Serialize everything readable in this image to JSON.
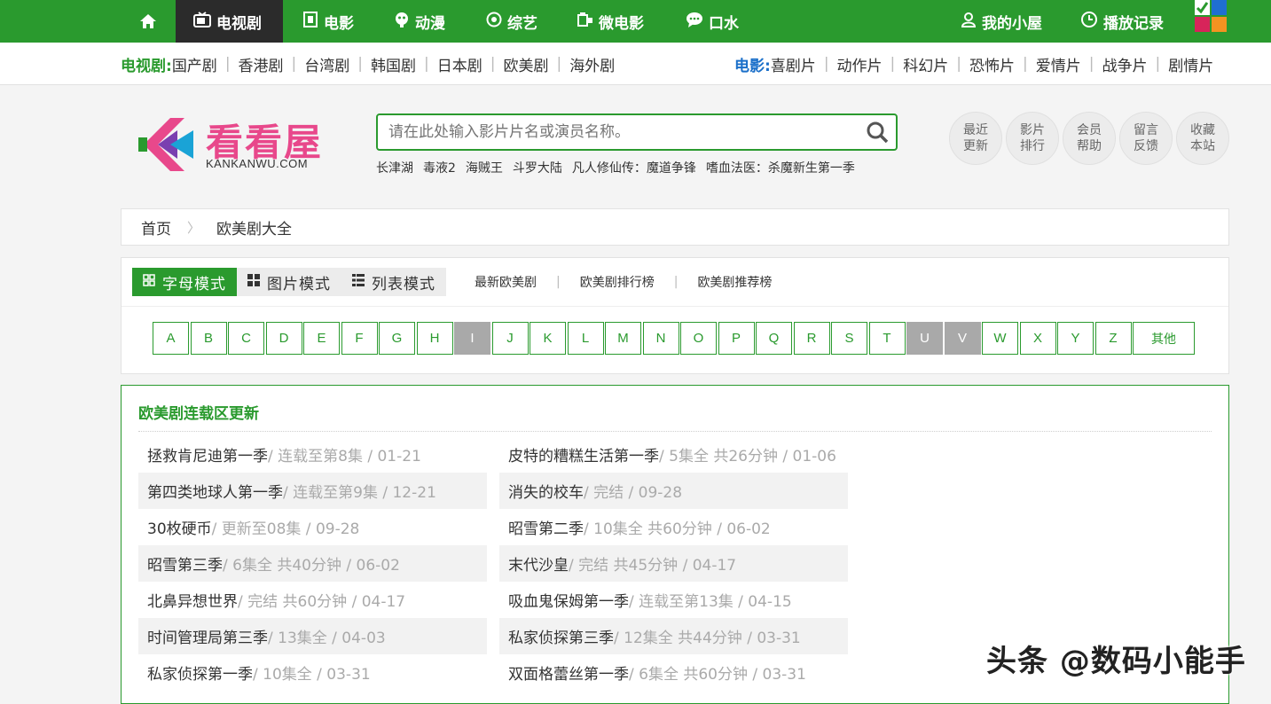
{
  "topnav": {
    "items": [
      {
        "label": "电视剧",
        "icon": "tv-icon"
      },
      {
        "label": "电影",
        "icon": "film-icon"
      },
      {
        "label": "动漫",
        "icon": "anime-icon"
      },
      {
        "label": "综艺",
        "icon": "variety-icon"
      },
      {
        "label": "微电影",
        "icon": "camera-icon"
      },
      {
        "label": "口水",
        "icon": "chat-icon"
      }
    ],
    "right": [
      {
        "label": "我的小屋",
        "icon": "user-icon"
      },
      {
        "label": "播放记录",
        "icon": "clock-icon"
      }
    ],
    "colors": {
      "green": "#2a9a2e",
      "active": "#2b2b2b"
    }
  },
  "subnav": {
    "tv_label": "电视剧:",
    "tv_links": [
      "国产剧",
      "香港剧",
      "台湾剧",
      "韩国剧",
      "日本剧",
      "欧美剧",
      "海外剧"
    ],
    "movie_label": "电影:",
    "movie_links": [
      "喜剧片",
      "动作片",
      "科幻片",
      "恐怖片",
      "爱情片",
      "战争片",
      "剧情片"
    ]
  },
  "logo": {
    "brand": "看看屋",
    "sub": "KANKANWU.COM"
  },
  "search": {
    "placeholder": "请在此处输入影片片名或演员名称。"
  },
  "hotwords": [
    "长津湖",
    "毒液2",
    "海贼王",
    "斗罗大陆",
    "凡人修仙传：魔道争锋",
    "嗜血法医：杀魔新生第一季"
  ],
  "quick": [
    [
      "最近",
      "更新"
    ],
    [
      "影片",
      "排行"
    ],
    [
      "会员",
      "帮助"
    ],
    [
      "留言",
      "反馈"
    ],
    [
      "收藏",
      "本站"
    ]
  ],
  "breadcrumb": {
    "home": "首页",
    "current": "欧美剧大全"
  },
  "modes": [
    {
      "label": "字母模式",
      "icon": "letter-grid-icon",
      "active": true
    },
    {
      "label": "图片模式",
      "icon": "image-grid-icon",
      "active": false
    },
    {
      "label": "列表模式",
      "icon": "list-icon",
      "active": false
    }
  ],
  "tab_links": [
    "最新欧美剧",
    "欧美剧排行榜",
    "欧美剧推荐榜"
  ],
  "letters": [
    {
      "ch": "A",
      "disabled": false
    },
    {
      "ch": "B",
      "disabled": false
    },
    {
      "ch": "C",
      "disabled": false
    },
    {
      "ch": "D",
      "disabled": false
    },
    {
      "ch": "E",
      "disabled": false
    },
    {
      "ch": "F",
      "disabled": false
    },
    {
      "ch": "G",
      "disabled": false
    },
    {
      "ch": "H",
      "disabled": false
    },
    {
      "ch": "I",
      "disabled": true
    },
    {
      "ch": "J",
      "disabled": false
    },
    {
      "ch": "K",
      "disabled": false
    },
    {
      "ch": "L",
      "disabled": false
    },
    {
      "ch": "M",
      "disabled": false
    },
    {
      "ch": "N",
      "disabled": false
    },
    {
      "ch": "O",
      "disabled": false
    },
    {
      "ch": "P",
      "disabled": false
    },
    {
      "ch": "Q",
      "disabled": false
    },
    {
      "ch": "R",
      "disabled": false
    },
    {
      "ch": "S",
      "disabled": false
    },
    {
      "ch": "T",
      "disabled": false
    },
    {
      "ch": "U",
      "disabled": true
    },
    {
      "ch": "V",
      "disabled": true
    },
    {
      "ch": "W",
      "disabled": false
    },
    {
      "ch": "X",
      "disabled": false
    },
    {
      "ch": "Y",
      "disabled": false
    },
    {
      "ch": "Z",
      "disabled": false
    },
    {
      "ch": "其他",
      "disabled": false
    }
  ],
  "updates": {
    "title": "欧美剧连载区更新",
    "left": [
      {
        "name": "拯救肯尼迪第一季",
        "meta": " / 连载至第8集 / 01-21"
      },
      {
        "name": "第四类地球人第一季",
        "meta": " / 连载至第9集 / 12-21"
      },
      {
        "name": "30枚硬币",
        "meta": " / 更新至08集 / 09-28"
      },
      {
        "name": "昭雪第三季",
        "meta": " / 6集全 共40分钟 / 06-02"
      },
      {
        "name": "北鼻异想世界",
        "meta": " / 完结 共60分钟 / 04-17"
      },
      {
        "name": "时间管理局第三季",
        "meta": " / 13集全 / 04-03"
      },
      {
        "name": "私家侦探第一季",
        "meta": " / 10集全 / 03-31"
      }
    ],
    "right": [
      {
        "name": "皮特的糟糕生活第一季",
        "meta": " / 5集全 共26分钟 / 01-06"
      },
      {
        "name": "消失的校车",
        "meta": " / 完结 / 09-28"
      },
      {
        "name": "昭雪第二季",
        "meta": " / 10集全 共60分钟 / 06-02"
      },
      {
        "name": "末代沙皇",
        "meta": " / 完结 共45分钟 / 04-17"
      },
      {
        "name": "吸血鬼保姆第一季",
        "meta": " / 连载至第13集 / 04-15"
      },
      {
        "name": "私家侦探第三季",
        "meta": " / 12集全 共44分钟 / 03-31"
      },
      {
        "name": "双面格蕾丝第一季",
        "meta": " / 6集全 共60分钟 / 03-31"
      }
    ]
  },
  "watermark": "头条 @数码小能手"
}
